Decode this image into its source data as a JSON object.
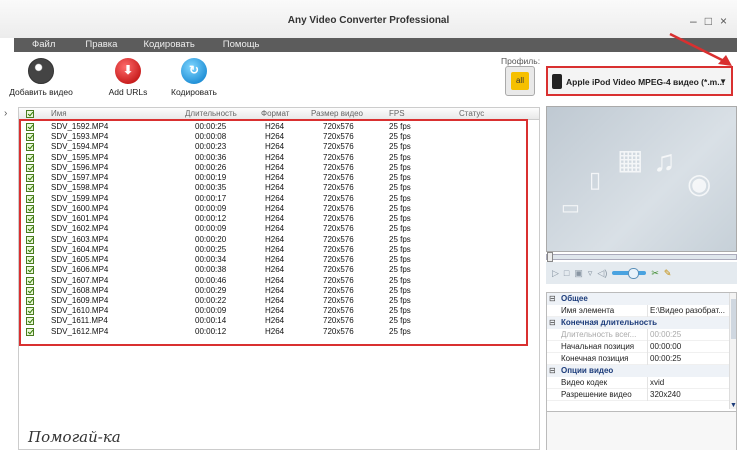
{
  "window": {
    "title": "Any Video Converter Professional",
    "min_glyph": "–",
    "max_glyph": "□",
    "close_glyph": "×"
  },
  "menu": {
    "items": [
      "Файл",
      "Правка",
      "Кодировать",
      "Помощь"
    ]
  },
  "toolbar": {
    "add_video": "Добавить видео",
    "add_urls": "Add URLs",
    "encode": "Кодировать"
  },
  "profile": {
    "label": "Профиль:",
    "all_label": "all",
    "selected": "Apple iPod Video MPEG-4 видео (*.m..."
  },
  "table": {
    "columns": [
      "Имя",
      "Длительность",
      "Формат",
      "Размер видео",
      "FPS",
      "Статус"
    ],
    "rows": [
      [
        "SDV_1592.MP4",
        "00:00:25",
        "H264",
        "720x576",
        "25 fps"
      ],
      [
        "SDV_1593.MP4",
        "00:00:08",
        "H264",
        "720x576",
        "25 fps"
      ],
      [
        "SDV_1594.MP4",
        "00:00:23",
        "H264",
        "720x576",
        "25 fps"
      ],
      [
        "SDV_1595.MP4",
        "00:00:36",
        "H264",
        "720x576",
        "25 fps"
      ],
      [
        "SDV_1596.MP4",
        "00:00:26",
        "H264",
        "720x576",
        "25 fps"
      ],
      [
        "SDV_1597.MP4",
        "00:00:19",
        "H264",
        "720x576",
        "25 fps"
      ],
      [
        "SDV_1598.MP4",
        "00:00:35",
        "H264",
        "720x576",
        "25 fps"
      ],
      [
        "SDV_1599.MP4",
        "00:00:17",
        "H264",
        "720x576",
        "25 fps"
      ],
      [
        "SDV_1600.MP4",
        "00:00:09",
        "H264",
        "720x576",
        "25 fps"
      ],
      [
        "SDV_1601.MP4",
        "00:00:12",
        "H264",
        "720x576",
        "25 fps"
      ],
      [
        "SDV_1602.MP4",
        "00:00:09",
        "H264",
        "720x576",
        "25 fps"
      ],
      [
        "SDV_1603.MP4",
        "00:00:20",
        "H264",
        "720x576",
        "25 fps"
      ],
      [
        "SDV_1604.MP4",
        "00:00:25",
        "H264",
        "720x576",
        "25 fps"
      ],
      [
        "SDV_1605.MP4",
        "00:00:34",
        "H264",
        "720x576",
        "25 fps"
      ],
      [
        "SDV_1606.MP4",
        "00:00:38",
        "H264",
        "720x576",
        "25 fps"
      ],
      [
        "SDV_1607.MP4",
        "00:00:46",
        "H264",
        "720x576",
        "25 fps"
      ],
      [
        "SDV_1608.MP4",
        "00:00:29",
        "H264",
        "720x576",
        "25 fps"
      ],
      [
        "SDV_1609.MP4",
        "00:00:22",
        "H264",
        "720x576",
        "25 fps"
      ],
      [
        "SDV_1610.MP4",
        "00:00:09",
        "H264",
        "720x576",
        "25 fps"
      ],
      [
        "SDV_1611.MP4",
        "00:00:14",
        "H264",
        "720x576",
        "25 fps"
      ],
      [
        "SDV_1612.MP4",
        "00:00:12",
        "H264",
        "720x576",
        "25 fps"
      ]
    ]
  },
  "properties": {
    "general": "Общее",
    "element_name_key": "Имя элемента",
    "element_name_val": "E:\\Видео разобрат...",
    "final_duration": "Конечная длительность",
    "total_duration_key": "Длительность всег...",
    "total_duration_val": "00:00:25",
    "start_pos_key": "Начальная позиция",
    "start_pos_val": "00:00:00",
    "end_pos_key": "Конечная позиция",
    "end_pos_val": "00:00:25",
    "video_options": "Опции видео",
    "video_codec_key": "Видео кодек",
    "video_codec_val": "xvid",
    "video_res_key": "Разрешение видео",
    "video_res_val": "320x240"
  },
  "watermark": "Помогай-ка",
  "colors": {
    "highlight_red": "#d93030",
    "menu_bg": "#5c5c5c",
    "check_green": "#2f7a00"
  }
}
